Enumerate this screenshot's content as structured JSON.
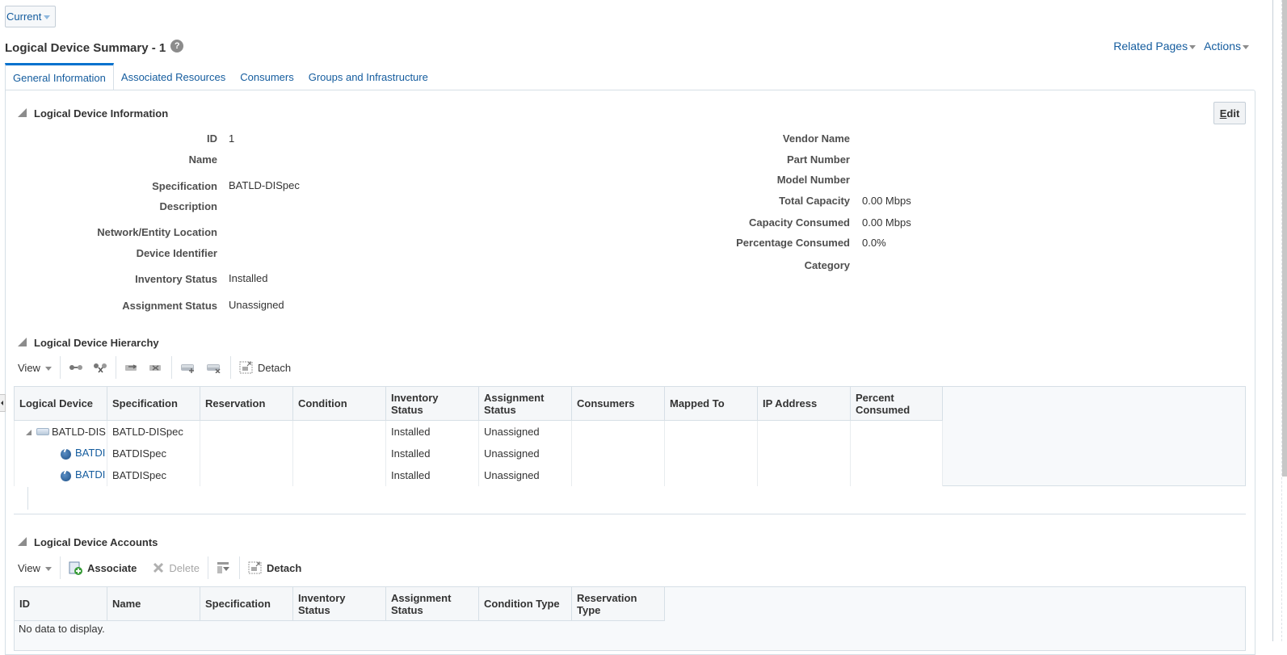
{
  "header": {
    "current_label": "Current",
    "page_title": "Logical Device Summary - 1",
    "help_symbol": "?",
    "related_pages_label": "Related Pages",
    "actions_label": "Actions"
  },
  "tabs": [
    {
      "label": "General Information",
      "active": true
    },
    {
      "label": "Associated Resources",
      "active": false
    },
    {
      "label": "Consumers",
      "active": false
    },
    {
      "label": "Groups and Infrastructure",
      "active": false
    }
  ],
  "info_section": {
    "title": "Logical Device Information",
    "edit_label": "Edit",
    "edit_mnemonic": "E",
    "edit_rest": "dit",
    "left_fields": [
      {
        "label": "ID",
        "value": "1"
      },
      {
        "label": "Name",
        "value": ""
      },
      {
        "label": "Specification",
        "value": "BATLD-DISpec",
        "link": true
      },
      {
        "label": "Description",
        "value": ""
      },
      {
        "label": "Network/Entity Location",
        "value": ""
      },
      {
        "label": "Device Identifier",
        "value": ""
      },
      {
        "label": "Inventory Status",
        "value": "Installed"
      },
      {
        "label": "Assignment Status",
        "value": "Unassigned"
      }
    ],
    "right_fields": [
      {
        "label": "Vendor Name",
        "value": ""
      },
      {
        "label": "Part Number",
        "value": ""
      },
      {
        "label": "Model Number",
        "value": ""
      },
      {
        "label": "Total Capacity",
        "value": "0.00 Mbps"
      },
      {
        "label": "Capacity Consumed",
        "value": "0.00 Mbps"
      },
      {
        "label": "Percentage Consumed",
        "value": "0.0%"
      },
      {
        "label": "Category",
        "value": ""
      }
    ]
  },
  "hierarchy_section": {
    "title": "Logical Device Hierarchy",
    "toolbar": {
      "view_label": "View",
      "icons": [
        "expand-all-icon",
        "collapse-all-icon",
        "move-up-icon",
        "move-down-icon",
        "add-device-icon",
        "remove-device-icon"
      ],
      "detach_label": "Detach"
    },
    "columns": [
      "Logical Device",
      "Specification",
      "Reservation",
      "Condition",
      "Inventory Status",
      "Assignment Status",
      "Consumers",
      "Mapped To",
      "IP Address",
      "Percent Consumed"
    ],
    "column_lines": [
      [
        "Logical Device"
      ],
      [
        "Specification"
      ],
      [
        "Reservation"
      ],
      [
        "Condition"
      ],
      [
        "Inventory",
        "Status"
      ],
      [
        "Assignment",
        "Status"
      ],
      [
        "Consumers"
      ],
      [
        "Mapped To"
      ],
      [
        "IP Address"
      ],
      [
        "Percent",
        "Consumed"
      ]
    ],
    "rows": [
      {
        "device": "BATLD-DIS",
        "device_link": false,
        "level": 0,
        "specification": "BATLD-DISpec",
        "reservation": "",
        "condition": "",
        "inventory_status": "Installed",
        "assignment_status": "Unassigned",
        "consumers": "",
        "mapped_to": "",
        "ip_address": "",
        "percent_consumed": ""
      },
      {
        "device": "BATDI",
        "device_link": true,
        "level": 1,
        "specification": "BATDISpec",
        "reservation": "",
        "condition": "",
        "inventory_status": "Installed",
        "assignment_status": "Unassigned",
        "consumers": "",
        "mapped_to": "",
        "ip_address": "",
        "percent_consumed": ""
      },
      {
        "device": "BATDI",
        "device_link": true,
        "level": 1,
        "specification": "BATDISpec",
        "reservation": "",
        "condition": "",
        "inventory_status": "Installed",
        "assignment_status": "Unassigned",
        "consumers": "",
        "mapped_to": "",
        "ip_address": "",
        "percent_consumed": ""
      }
    ]
  },
  "accounts_section": {
    "title": "Logical Device Accounts",
    "toolbar": {
      "view_label": "View",
      "associate_label": "Associate",
      "delete_label": "Delete",
      "detach_label": "Detach"
    },
    "column_lines": [
      [
        "ID"
      ],
      [
        "Name"
      ],
      [
        "Specification"
      ],
      [
        "Inventory",
        "Status"
      ],
      [
        "Assignment",
        "Status"
      ],
      [
        "Condition Type"
      ],
      [
        "Reservation",
        "Type"
      ]
    ],
    "empty_text": "No data to display."
  },
  "colors": {
    "link": "#145c9e",
    "active_tab_border": "#0572ce",
    "header_bg": "#f5f7f9",
    "border": "#d6dfe6"
  }
}
